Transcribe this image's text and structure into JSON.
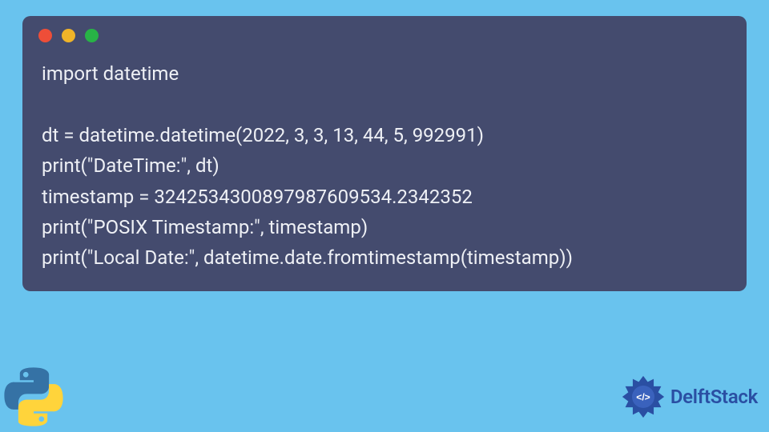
{
  "code": {
    "lines": [
      "import datetime",
      "",
      "dt = datetime.datetime(2022, 3, 3, 13, 44, 5, 992991)",
      "print(\"DateTime:\", dt)",
      "timestamp = 3242534300897987609534.2342352",
      "print(\"POSIX Timestamp:\", timestamp)",
      "print(\"Local Date:\", datetime.date.fromtimestamp(timestamp))"
    ]
  },
  "brand": {
    "name": "DelftStack"
  }
}
